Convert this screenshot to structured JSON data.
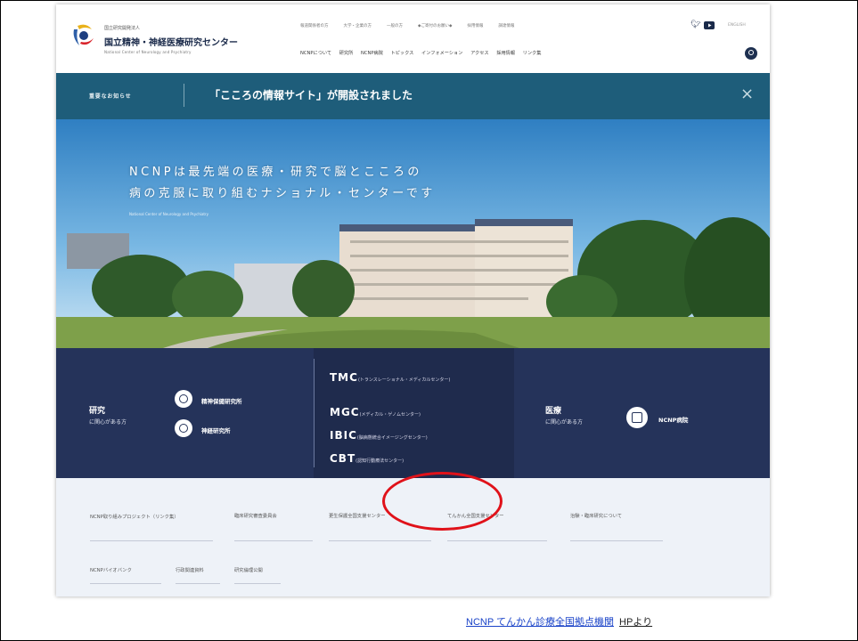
{
  "header": {
    "logo_sub": "国立研究開発法人",
    "logo_name": "国立精神・神経医療研究センター",
    "logo_en": "National Center of Neurology and Psychiatry",
    "util_links": [
      "報道関係者の方",
      "大学・企業の方",
      "一般の方",
      "◆ご寄付のお願い◆",
      "採用情報",
      "調達情報"
    ],
    "lang_link": "ENGLISH",
    "nav": [
      "NCNPについて",
      "研究所",
      "NCNP病院",
      "トピックス",
      "インフォメーション",
      "アクセス",
      "採用情報",
      "リンク集"
    ]
  },
  "notice": {
    "label": "重要なお知らせ",
    "text": "「こころの情報サイト」が開設されました",
    "close": "×"
  },
  "hero": {
    "line1": "NCNPは最先端の医療・研究で脳とこころの",
    "line2": "病の克服に取り組むナショナル・センターです",
    "sub": "National Center of Neurology and Psychiatry"
  },
  "band": {
    "research_title": "研究",
    "research_sub": "に関心がある方",
    "research_items": [
      "精神保健研究所",
      "神経研究所"
    ],
    "centers": [
      {
        "abbr": "TMC",
        "name": "(トランスレーショナル・メディカルセンター)"
      },
      {
        "abbr": "MGC",
        "name": "(メディカル・ゲノムセンター)"
      },
      {
        "abbr": "IBIC",
        "name": "(脳病態統合イメージングセンター)"
      },
      {
        "abbr": "CBT",
        "name": "(認知行動療法センター)"
      }
    ],
    "medical_title": "医療",
    "medical_sub": "に関心がある方",
    "medical_item": "NCNP病院"
  },
  "links": {
    "row1": [
      "NCNP取り組みプロジェクト（リンク集）",
      "臨床研究審査委員会",
      "更生保護全国支援センター",
      "てんかん全国支援センター",
      "治験・臨床研究について"
    ],
    "row2": [
      "NCNPバイオバンク",
      "行政関連資料",
      "研究倫理公開"
    ]
  },
  "caption": {
    "link": "NCNP てんかん診療全国拠点機関",
    "suffix": "HPより"
  },
  "colors": {
    "notice_bg": "#1e5d7a",
    "band_bg": "#25335a",
    "highlight": "#e0121a",
    "link": "#1a43c8"
  }
}
